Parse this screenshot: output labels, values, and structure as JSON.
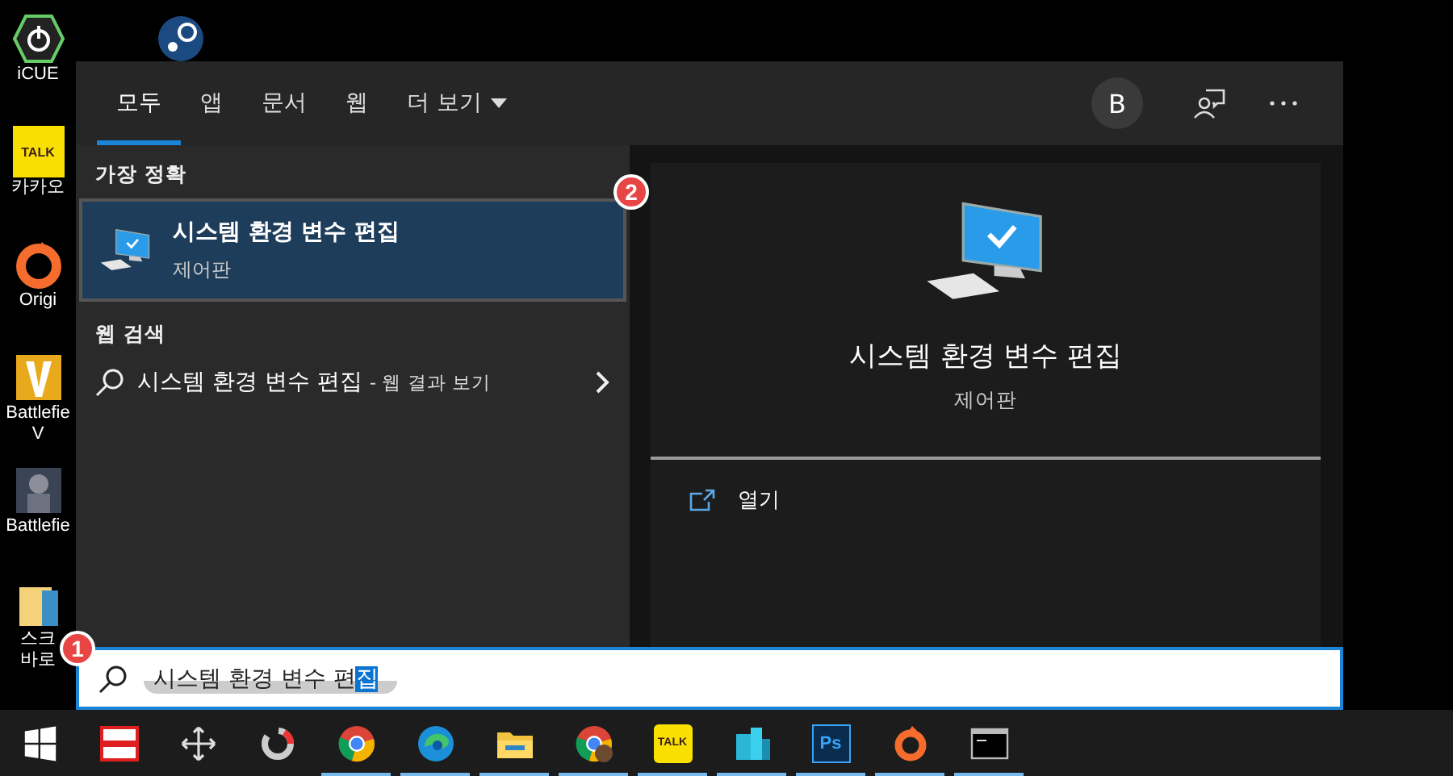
{
  "desktop_icons": [
    {
      "kind": "icue",
      "lines": [
        "iCUE"
      ]
    },
    {
      "kind": "kakao",
      "badge_text": "TALK",
      "lines": [
        "카카오"
      ]
    },
    {
      "kind": "origin",
      "lines": [
        "Origi"
      ]
    },
    {
      "kind": "battlefield-v",
      "lines": [
        "Battlefie",
        "V"
      ]
    },
    {
      "kind": "battlefield",
      "lines": [
        "Battlefie"
      ]
    },
    {
      "kind": "folder",
      "lines": [
        "스크",
        "바로"
      ]
    },
    {
      "kind": "steam"
    }
  ],
  "search_panel": {
    "tabs": [
      {
        "label": "모두",
        "selected": true,
        "dropdown": false
      },
      {
        "label": "앱",
        "selected": false,
        "dropdown": false
      },
      {
        "label": "문서",
        "selected": false,
        "dropdown": false
      },
      {
        "label": "웹",
        "selected": false,
        "dropdown": false
      },
      {
        "label": "더 보기",
        "selected": false,
        "dropdown": true
      }
    ],
    "account_initial": "B",
    "best_match": {
      "heading": "가장 정확",
      "title": "시스템 환경 변수 편집",
      "subtitle": "제어판",
      "selected": true
    },
    "web_search": {
      "heading": "웹 검색",
      "text": "시스템 환경 변수 편집",
      "suffix": "- 웹 결과 보기"
    },
    "preview": {
      "title": "시스템 환경 변수 편집",
      "subtitle": "제어판",
      "actions": [
        {
          "label": "열기"
        }
      ]
    }
  },
  "search_box": {
    "value": "시스템 환경 변수 편",
    "selected_text": "집"
  },
  "taskbar": [
    {
      "kind": "start",
      "running": false
    },
    {
      "kind": "redbox",
      "running": false
    },
    {
      "kind": "move",
      "running": false
    },
    {
      "kind": "ring",
      "running": false
    },
    {
      "kind": "chrome",
      "running": true
    },
    {
      "kind": "edge",
      "running": true
    },
    {
      "kind": "explorer",
      "running": true
    },
    {
      "kind": "chrome-profile",
      "running": true
    },
    {
      "kind": "kakao",
      "label": "TALK",
      "running": true
    },
    {
      "kind": "buildings",
      "running": true
    },
    {
      "kind": "photoshop",
      "label": "Ps",
      "running": true
    },
    {
      "kind": "origin",
      "running": true
    },
    {
      "kind": "terminal",
      "running": true
    }
  ],
  "annotations": [
    {
      "text": "2"
    },
    {
      "text": "1"
    }
  ]
}
